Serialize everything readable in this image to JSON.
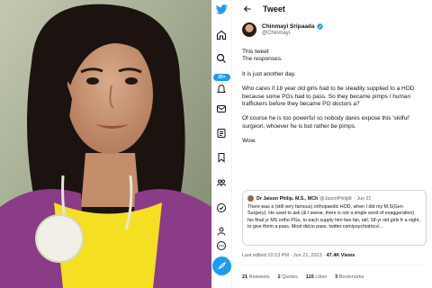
{
  "nav": {
    "notifications_badge": "20+"
  },
  "header": {
    "title": "Tweet"
  },
  "tweet": {
    "author_name": "Chinmayi Sripaada",
    "author_handle": "@Chinmayi",
    "paragraphs": [
      "This tweet\nThe responses.",
      "It is just another day.",
      "Who cares if 18 year old girls had to be steadily supplied to a HOD because some PGs had to pass. So they became pimps / human traffickers before they became PG doctors a?",
      "Of course he is too powerful so nobody dares expose this 'skilful' surgeon, whoever he is but rather be pimps.",
      "Wow."
    ],
    "quoted": {
      "name": "Dr Jaison Philip. M.S., MCh",
      "handle": "@JasonPhilip8",
      "date": "Jun 21",
      "text": "There was a (still very famous) orthopaedic HOD, when I did my M.S(Gen Surgery). He used to ask (& I swear, there is not a single word of exaggeration) his final yr MS ortho PGs, to each supply him two fair, tall, 18-yr old girls fr a night, to give them a pass. Most did,to pass. twitter.com/psychiatrics/..."
    },
    "meta_line": "Last edited 10:13 PM · Jun 21, 2023 · ",
    "views": "47.4K Views",
    "stats": {
      "retweets": "21",
      "retweets_label": "Retweets",
      "quotes": "2",
      "quotes_label": "Quotes",
      "likes": "115",
      "likes_label": "Likes",
      "bookmarks": "3",
      "bookmarks_label": "Bookmarks"
    }
  },
  "colors": {
    "accent": "#1d9bf0",
    "text": "#0f1419",
    "secondary": "#536471"
  }
}
